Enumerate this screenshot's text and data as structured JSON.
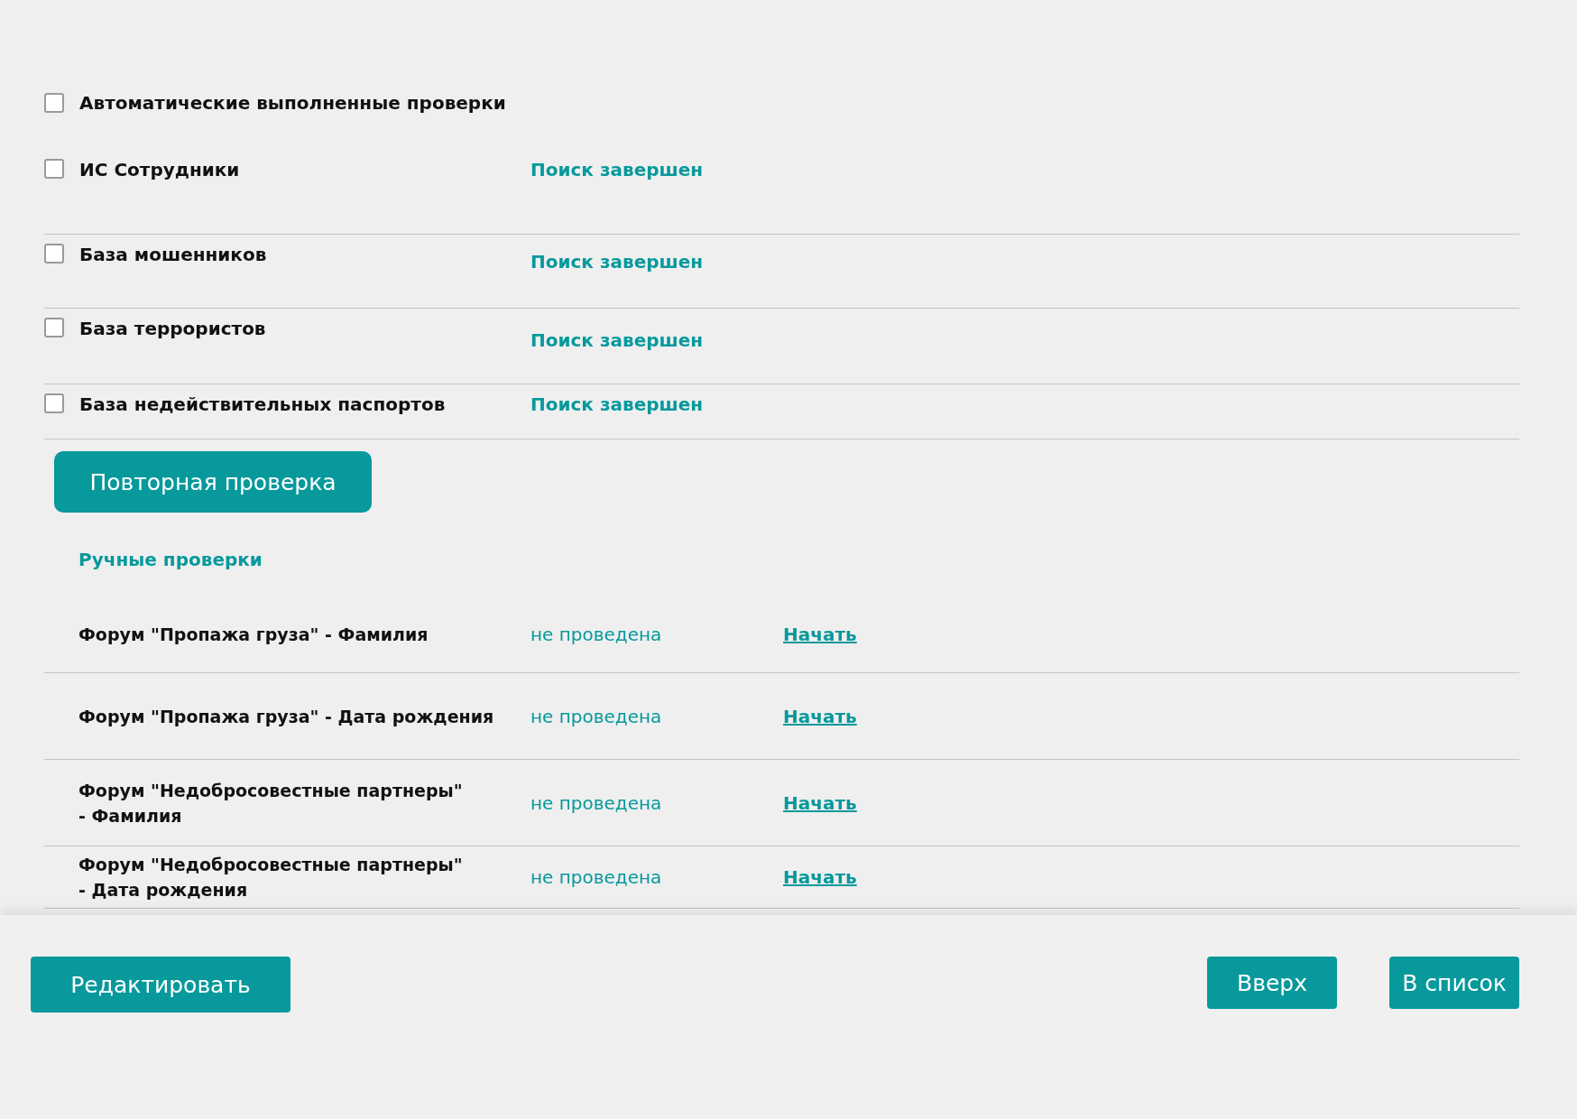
{
  "auto_checks": {
    "title": "Автоматические выполненные проверки",
    "checked": false,
    "items": [
      {
        "name": "ИС Сотрудники",
        "status": "Поиск завершен",
        "checked": false
      },
      {
        "name": "База мошенников",
        "status": "Поиск завершен",
        "checked": false
      },
      {
        "name": "База террористов",
        "status": "Поиск завершен",
        "checked": false
      },
      {
        "name": "База недействительных паспортов",
        "status": "Поиск завершен",
        "checked": false
      }
    ]
  },
  "recheck_button": "Повторная проверка",
  "manual_checks": {
    "title": "Ручные проверки",
    "items": [
      {
        "name": "Форум \"Пропажа груза\" - Фамилия",
        "status": "не проведена",
        "action": "Начать"
      },
      {
        "name": "Форум \"Пропажа груза\" - Дата рождения",
        "status": "не проведена",
        "action": "Начать"
      },
      {
        "name": "Форум \"Недобросовестные партнеры\"\n - Фамилия",
        "status": "не проведена",
        "action": "Начать"
      },
      {
        "name": "Форум \"Недобросовестные партнеры\"\n - Дата рождения",
        "status": "не проведена",
        "action": "Начать"
      }
    ]
  },
  "footer": {
    "edit_button": "Редактировать",
    "up_button": "Вверх",
    "list_button": "В список"
  }
}
